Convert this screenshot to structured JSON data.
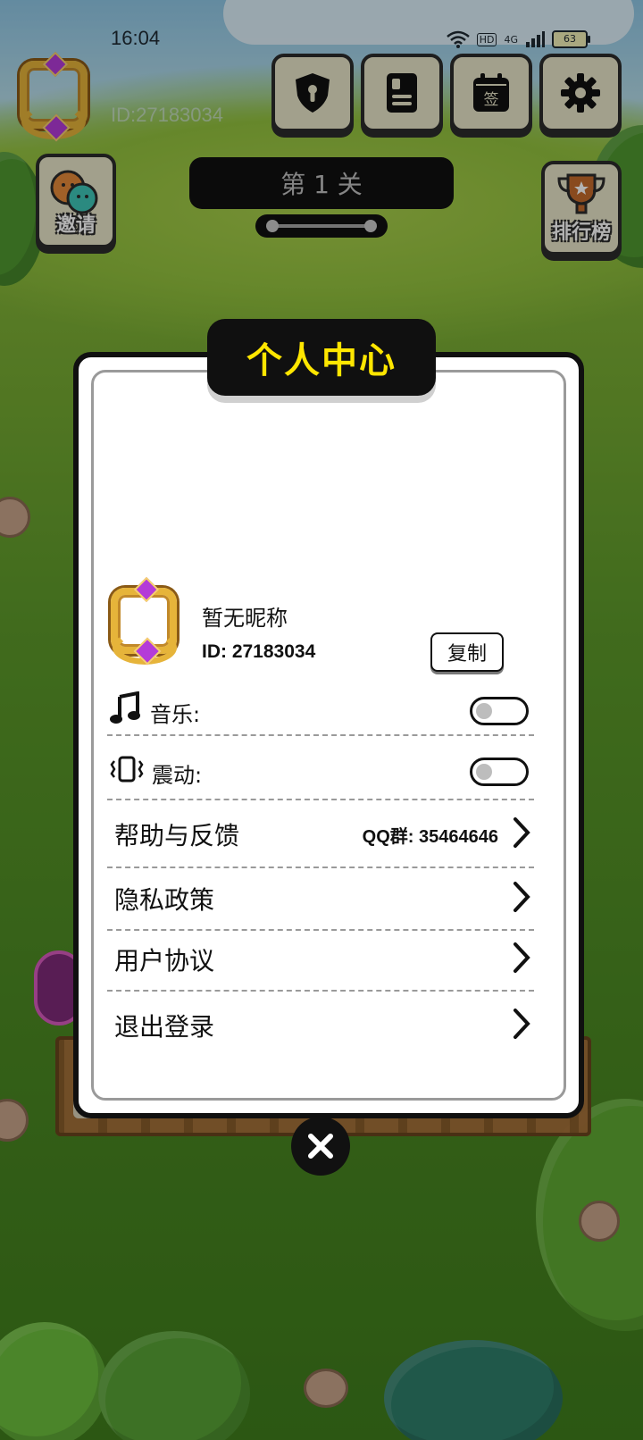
{
  "status_bar": {
    "time": "16:04",
    "network": "4G",
    "hd": "HD",
    "battery": "63"
  },
  "top": {
    "user_id": "ID:27183034"
  },
  "top_buttons": [
    {
      "icon": "shield-lock-icon"
    },
    {
      "icon": "id-card-icon"
    },
    {
      "icon": "calendar-sign-icon",
      "label": "签"
    },
    {
      "icon": "gear-icon"
    }
  ],
  "side_buttons": {
    "invite": "邀请",
    "leaderboard": "排行榜"
  },
  "level": {
    "label": "第 1 关"
  },
  "modal": {
    "title": "个人中心",
    "nickname": "暂无昵称",
    "id": "ID: 27183034",
    "copy_button": "复制",
    "music": {
      "label": "音乐:",
      "enabled": false
    },
    "vibration": {
      "label": "震动:",
      "enabled": false
    },
    "help": {
      "label": "帮助与反馈",
      "qq_group": "QQ群: 35464646"
    },
    "privacy": {
      "label": "隐私政策"
    },
    "agreement": {
      "label": "用户协议"
    },
    "logout": {
      "label": "退出登录"
    }
  },
  "colors": {
    "title_text": "#ffe600",
    "modal_border": "#101010",
    "frame_gold": "#e6b43a",
    "grass": "#5d9a2a"
  }
}
